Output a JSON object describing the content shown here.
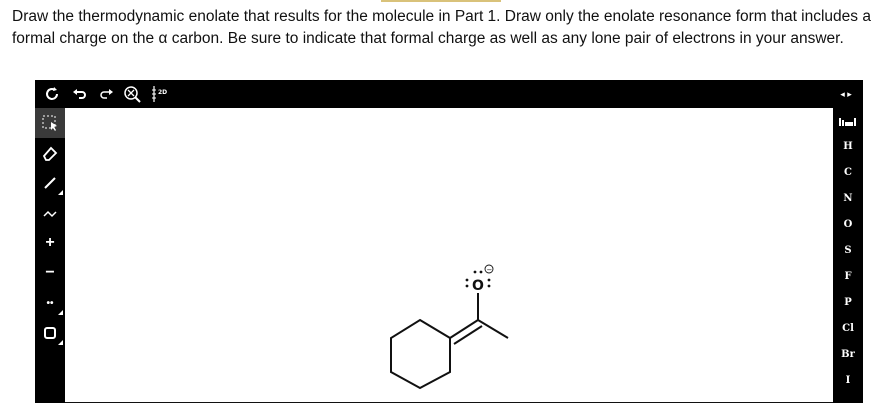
{
  "question": {
    "text": "Draw the thermodynamic enolate that results for the molecule in Part 1. Draw only the enolate resonance form that includes a formal charge on the α carbon. Be sure to indicate that formal charge as well as any lone pair of electrons in your answer."
  },
  "toolbar": {
    "items": [
      {
        "name": "clear-icon",
        "glyph": "⟳"
      },
      {
        "name": "undo-icon",
        "glyph": "↶"
      },
      {
        "name": "redo-icon",
        "glyph": "↷"
      },
      {
        "name": "zoom-icon",
        "glyph": "⊗"
      },
      {
        "name": "2d-clean-icon",
        "glyph": "2D"
      }
    ],
    "expand_glyph": "◂ ▸"
  },
  "tools": [
    {
      "name": "select-tool",
      "glyph": "⬚"
    },
    {
      "name": "eraser-tool",
      "glyph": "⌀"
    },
    {
      "name": "bond-tool",
      "glyph": "╱"
    },
    {
      "name": "chain-tool",
      "glyph": "⩘"
    },
    {
      "name": "positive-charge-tool",
      "glyph": "+"
    },
    {
      "name": "negative-charge-tool",
      "glyph": "−"
    },
    {
      "name": "lone-pair-tool",
      "glyph": "••"
    },
    {
      "name": "ring-tool",
      "glyph": "□"
    }
  ],
  "atoms": [
    "H",
    "C",
    "N",
    "O",
    "S",
    "F",
    "P",
    "Cl",
    "Br",
    "I"
  ],
  "periodic_table_icon": "periodic-table-icon",
  "molecule": {
    "oxygen_label": "O",
    "charge": "−"
  }
}
